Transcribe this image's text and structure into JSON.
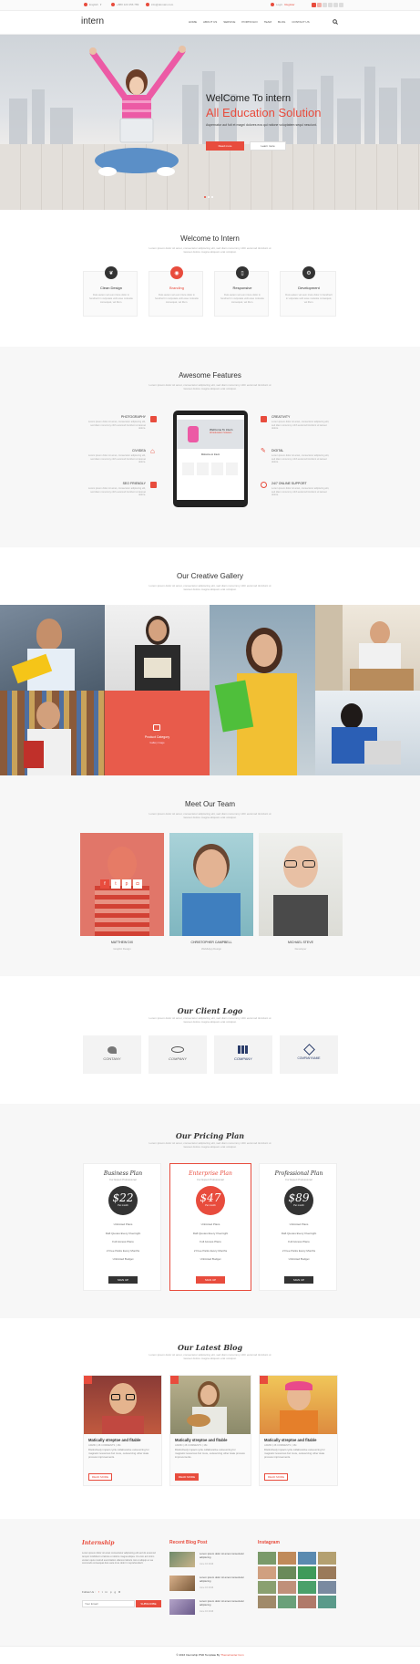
{
  "topbar": {
    "lang": "English",
    "phone": "+880 123 456 789",
    "email": "info@domain.com",
    "login": "Login",
    "register": "Register"
  },
  "nav": {
    "brand": "intern",
    "items": [
      "HOME",
      "ABOUT US",
      "SERVICE",
      "PORTFOLIO",
      "TEAM",
      "BLOG",
      "CONTACT US"
    ]
  },
  "hero": {
    "line1": "WelCome To intern",
    "line2": "All Education Solution",
    "desc": "Aspernatur aut fuit et magni dolores eos qui ratione voluptatem sequi nesciunt.",
    "btn_primary": "Read more",
    "btn_secondary": "Learn more"
  },
  "welcome": {
    "title": "Welcome to Intern",
    "subtitle": "Lorem ipsum dolor sit amet, consectetur adipiscing elit, sed diam nonummy nibh euismod tincidunt ut laoreet dolore magna aliquam erat volutpat.",
    "cards": [
      {
        "title": "Clean Design",
        "text": "Duis autem vel eum iriure dolor in hendrerit in vulputate velit esse molestie consequat, vel illum.",
        "active": false
      },
      {
        "title": "Branding",
        "text": "Duis autem vel eum iriure dolor in hendrerit in vulputate velit esse molestie consequat, vel illum.",
        "active": true
      },
      {
        "title": "Responsive",
        "text": "Duis autem vel eum iriure dolor in hendrerit in vulputate velit esse molestie consequat, vel illum.",
        "active": false
      },
      {
        "title": "Development",
        "text": "Duis autem vel eum iriure dolor in hendrerit in vulputate velit esse molestie consequat, vel illum.",
        "active": false
      }
    ]
  },
  "features": {
    "title": "Awesome Features",
    "subtitle": "Lorem ipsum dolor sit amet, consectetur adipiscing elit, sed diam nonummy nibh euismod tincidunt ut laoreet dolore magna aliquam erat volutpat.",
    "left": [
      {
        "title": "PHOTOGRAPHY",
        "text": "Lorem ipsum dolor sit amet, consectetur adipiscing elit, sed diam nonummy nibh euismod tincidunt ut laoreet dolore."
      },
      {
        "title": "CIV/IDEA",
        "text": "Lorem ipsum dolor sit amet, consectetur adipiscing elit, sed diam nonummy nibh euismod tincidunt ut laoreet dolore."
      },
      {
        "title": "SEO FRIENDLY",
        "text": "Lorem ipsum dolor sit amet, consectetur adipiscing elit, sed diam nonummy nibh euismod tincidunt ut laoreet dolore."
      }
    ],
    "right": [
      {
        "title": "CREATIVITY",
        "text": "Lorem ipsum dolor sit amet, consectetur adipiscing elit, sed diam nonummy nibh euismod tincidunt ut laoreet dolore."
      },
      {
        "title": "DIGITAL",
        "text": "Lorem ipsum dolor sit amet, consectetur adipiscing elit, sed diam nonummy nibh euismod tincidunt ut laoreet dolore."
      },
      {
        "title": "24/7 ONLINE SUPPORT",
        "text": "Lorem ipsum dolor sit amet, consectetur adipiscing elit, sed diam nonummy nibh euismod tincidunt ut laoreet dolore."
      }
    ],
    "screen_line1": "WelCome To intern",
    "screen_line2": "All Education Solution",
    "screen_section": "Welcome to Intern"
  },
  "gallery": {
    "title": "Our Creative Gallery",
    "subtitle": "Lorem ipsum dolor sit amet, consectetur adipiscing elit, sed diam nonummy nibh euismod tincidunt ut laoreet dolore magna aliquam erat volutpat.",
    "overlay_title": "Product Category",
    "overlay_sub": "Gallery Image"
  },
  "team": {
    "title": "Meet Our Team",
    "subtitle": "Lorem ipsum dolor sit amet, consectetur adipiscing elit, sed diam nonummy nibh euismod tincidunt ut laoreet dolore magna aliquam erat volutpat.",
    "members": [
      {
        "name": "MATTHEW DIX",
        "role": "Graphic Design"
      },
      {
        "name": "CHRISTOPHER CAMPBELL",
        "role": "Web&App Design"
      },
      {
        "name": "MICHAEL STEVE",
        "role": "Developer"
      }
    ]
  },
  "clients": {
    "title": "Our Client Logo",
    "subtitle": "Lorem ipsum dolor sit amet, consectetur adipiscing elit, sed diam nonummy nibh euismod tincidunt ut laoreet dolore magna aliquam erat volutpat.",
    "logos": [
      "CONTANY",
      "COMPANY",
      "COMPANY",
      "COMPANYNAME"
    ]
  },
  "pricing": {
    "title": "Our Pricing Plan",
    "subtitle": "Lorem ipsum dolor sit amet, consectetur adipiscing elit, sed diam nonummy nibh euismod tincidunt ut laoreet dolore magna aliquam erat volutpat.",
    "plans": [
      {
        "name": "Business Plan",
        "tag": "For Expert Professional",
        "price": "$22",
        "per": "Per month",
        "features": [
          "Unlimited Plans",
          "Daft Quotes Every Overnight",
          "Full Access Plans",
          "2 Free Parks Every Months",
          "Unlimited Budget"
        ],
        "cta": "SIGN UP",
        "featured": false
      },
      {
        "name": "Enterprise Plan",
        "tag": "For Expert Professional",
        "price": "$47",
        "per": "Per month",
        "features": [
          "Unlimited Plans",
          "Daft Quotes Every Overnight",
          "Full Access Plans",
          "2 Free Parks Every Months",
          "Unlimited Budget"
        ],
        "cta": "SIGN UP",
        "featured": true
      },
      {
        "name": "Professional Plan",
        "tag": "For Expert Professional",
        "price": "$89",
        "per": "Per month",
        "features": [
          "Unlimited Plans",
          "Daft Quotes Every Overnight",
          "Full Access Plans",
          "2 Free Parks Every Months",
          "Unlimited Budget"
        ],
        "cta": "SIGN UP",
        "featured": false
      }
    ]
  },
  "blog": {
    "title": "Our Latest Blog",
    "subtitle": "Lorem ipsum dolor sit amet, consectetur adipiscing elit, sed diam nonummy nibh euismod tincidunt ut laoreet dolore magna aliquam erat volutpat.",
    "posts": [
      {
        "title": "Matically streptoe and fitable",
        "meta": "ADMIN  |  28 COMMENTS  |  15k",
        "excerpt": "Distinctively impact cycle collaborative outsourcing for magnetic resources but more, outsourcing other state process improvements.",
        "cta": "READ MORE"
      },
      {
        "title": "Matically streptoe and fitable",
        "meta": "ADMIN  |  28 COMMENTS  |  15k",
        "excerpt": "Distinctively impact cycle collaborative outsourcing for magnetic resources but more, outsourcing other state process improvements.",
        "cta": "READ MORE"
      },
      {
        "title": "Matically streptoe and fitable",
        "meta": "ADMIN  |  28 COMMENTS  |  15k",
        "excerpt": "Distinctively impact cycle collaborative outsourcing for magnetic resources but more, outsourcing other state process improvements.",
        "cta": "READ MORE"
      }
    ]
  },
  "footer": {
    "about_title": "Internship",
    "about_text": "Lorem ipsum dolor sit amet consectetur adipiscing elit sed do eiusmod tempor incididunt ut labore et dolore magna aliqua. Ut enim ad minim veniam quis nostrud exercitation ullamco laboris nisi ut aliquip ex ea commodo consequat duis aute irure dolor in reprehenderit.",
    "follow": "Follow Us :",
    "subscribe_placeholder": "Your Email",
    "subscribe_btn": "SUBSCRIBE",
    "recent_title": "Recent Blog Post",
    "recent_posts": [
      {
        "title": "Lorem ipsum dolor sit amet consectetur adipiscing",
        "date": "June 16 2016"
      },
      {
        "title": "Lorem ipsum dolor sit amet consectetur adipiscing",
        "date": "June 16 2016"
      },
      {
        "title": "Lorem ipsum dolor sit amet consectetur adipiscing",
        "date": "June 16 2016"
      }
    ],
    "instagram_title": "Instagram",
    "copyright": "© 2016 Internship PSD Template By ",
    "credit": "ThemeCenter.Com"
  },
  "colors": {
    "accent": "#e84c3d",
    "dark": "#333333",
    "section_gray": "#f7f7f7"
  }
}
